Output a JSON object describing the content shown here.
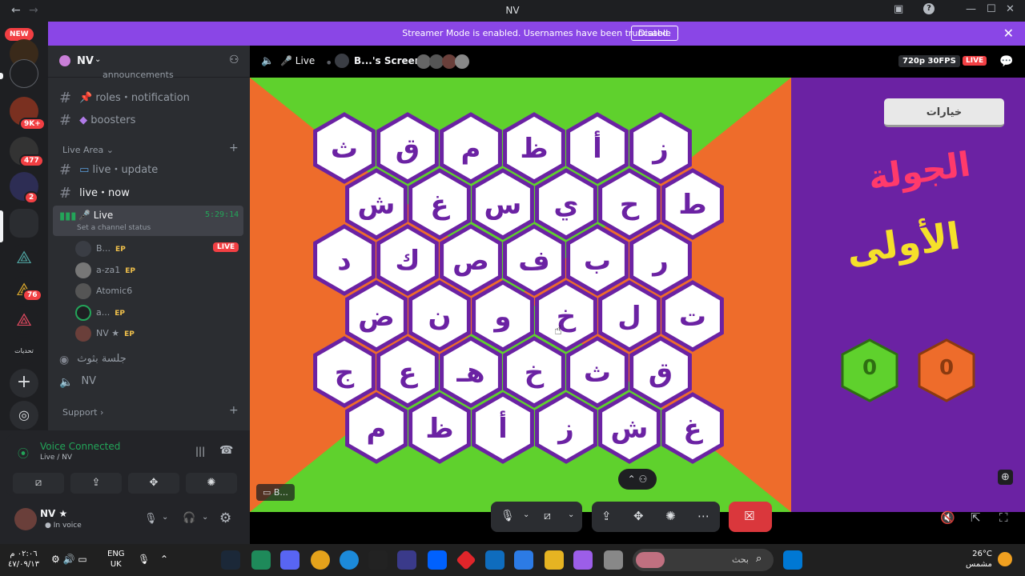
{
  "titlebar": {
    "title": "NV"
  },
  "rail": {
    "new_label": "NEW",
    "badges": [
      "9K+",
      "477",
      "2",
      "76"
    ],
    "server_labels": [
      "تحديات"
    ]
  },
  "banner": {
    "text": "Streamer Mode is enabled. Usernames have been truncated.",
    "disable": "Disable"
  },
  "guild": {
    "name": "NV"
  },
  "channels": {
    "ann": "announcements",
    "roles": "roles・notification",
    "boosters": "boosters",
    "live_area": "Live Area",
    "live_update": "live・update",
    "live_now": "live・now",
    "voice_live": "Live",
    "voice_timer": "5:29:14",
    "channel_status": "Set a channel status",
    "stage": "جلسة بثوث",
    "nv_voice": "NV",
    "support": "Support"
  },
  "voice_users": [
    {
      "name": "B...",
      "tag": "EP",
      "live": "LIVE"
    },
    {
      "name": "a-za1",
      "tag": "EP"
    },
    {
      "name": "Atomic6",
      "tag": ""
    },
    {
      "name": "a...",
      "tag": "EP"
    },
    {
      "name": "NV ★",
      "tag": "EP"
    }
  ],
  "voice_panel": {
    "status": "Voice Connected",
    "location": "Live / NV"
  },
  "userbar": {
    "name": "NV ★",
    "status": "In voice"
  },
  "stream": {
    "channel": "Live",
    "screen": "B...'s Screen",
    "quality": "720p 30FPS",
    "live": "LIVE",
    "viewer_tag": "B..."
  },
  "board": {
    "rows": [
      [
        "ث",
        "ق",
        "م",
        "ظ",
        "أ",
        "ز"
      ],
      [
        "ش",
        "غ",
        "س",
        "ي",
        "ح",
        "ط"
      ],
      [
        "د",
        "ك",
        "ص",
        "ف",
        "ب",
        "ر"
      ],
      [
        "ض",
        "ن",
        "و",
        "خ",
        "ل",
        "ت"
      ],
      [
        "ج",
        "ع",
        "هـ",
        "خ",
        "ث",
        "ق"
      ],
      [
        "م",
        "ظ",
        "أ",
        "ز",
        "ش",
        "غ"
      ]
    ]
  },
  "side_panel": {
    "options": "خيارات",
    "round_line1": "الجولة",
    "round_line2": "الأولى",
    "score_green": "0",
    "score_orange": "0"
  },
  "taskbar": {
    "time": "٠٢:٠٦ م",
    "date": "٤٧/٠٩/١٣",
    "lang1": "ENG",
    "lang2": "UK",
    "search": "بحث",
    "weather_temp": "26°C",
    "weather_desc": "مشمس"
  },
  "colors": {
    "accent": "#8a46e6",
    "live_red": "#f23f43",
    "green": "#23a559",
    "board_green": "#5fd12d",
    "board_orange": "#ee6c2b",
    "hex_border": "#6b22a3"
  }
}
